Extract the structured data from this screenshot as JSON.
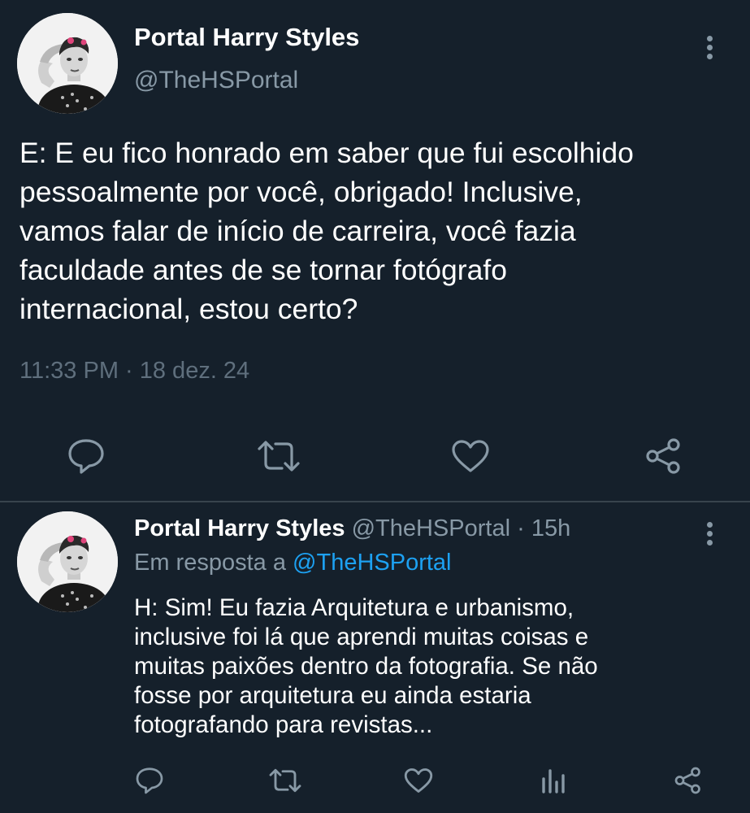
{
  "main_tweet": {
    "author_name": "Portal Harry Styles",
    "handle": "@TheHSPortal",
    "text_lines": [
      "E: E eu fico honrado em saber que fui escolhido",
      "pessoalmente por você, obrigado! Inclusive,",
      "vamos falar de início de carreira, você fazia",
      "faculdade antes de se tornar fotógrafo",
      "internacional, estou certo?"
    ],
    "meta": "11:33 PM · 18 dez. 24",
    "actions": [
      "reply-icon",
      "retweet-icon",
      "like-icon",
      "share-icon"
    ]
  },
  "reply_tweet": {
    "author_name": "Portal Harry Styles",
    "handle": "@TheHSPortal",
    "separator": "·",
    "time": "15h",
    "replying_prefix": "Em resposta a",
    "replying_to": "@TheHSPortal",
    "text_lines": [
      "H: Sim! Eu fazia Arquitetura e urbanismo,",
      "inclusive foi lá que aprendi muitas coisas e",
      "muitas paixões dentro da fotografia. Se não",
      "fosse por arquitetura eu ainda estaria",
      "fotografando para revistas..."
    ],
    "actions": [
      "reply-icon",
      "retweet-icon",
      "like-icon",
      "analytics-icon",
      "share-icon"
    ]
  },
  "colors": {
    "background": "#15202b",
    "primary_text": "#ffffff",
    "secondary_text": "#8899a6",
    "link": "#1da1f2",
    "divider": "#38444d"
  }
}
